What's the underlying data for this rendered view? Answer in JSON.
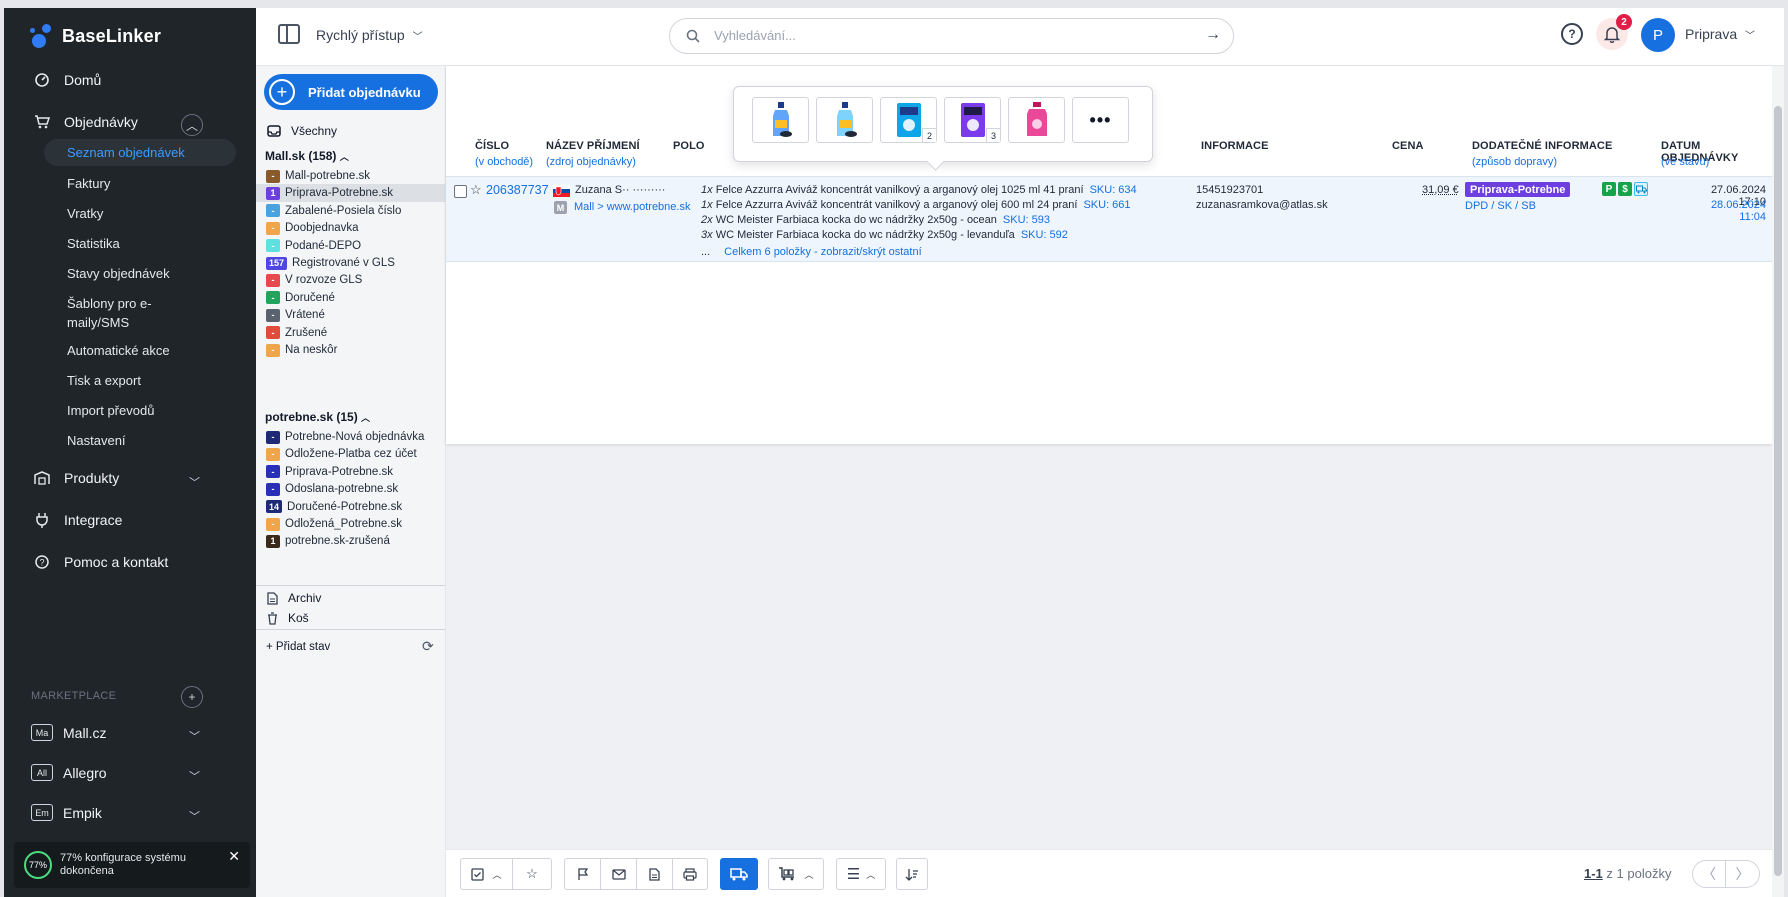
{
  "app": {
    "name": "BaseLinker"
  },
  "nav": {
    "home": "Domů",
    "orders": "Objednávky",
    "orders_sub": [
      "Seznam objednávek",
      "Faktury",
      "Vratky",
      "Statistika",
      "Stavy objednávek",
      "Šablony pro e-maily/SMS",
      "Automatické akce",
      "Tisk a export",
      "Import převodů",
      "Nastavení"
    ],
    "products": "Produkty",
    "integrations": "Integrace",
    "help": "Pomoc a kontakt",
    "marketplace_label": "MARKETPLACE",
    "marketplaces": [
      {
        "badge": "Ma",
        "name": "Mall.cz"
      },
      {
        "badge": "All",
        "name": "Allegro"
      },
      {
        "badge": "Em",
        "name": "Empik"
      }
    ],
    "config_percent": "77%",
    "config_text": "77% konfigurace systému dokončena"
  },
  "topbar": {
    "quick_access": "Rychlý přístup",
    "search_placeholder": "Vyhledávání...",
    "notifications": "2",
    "avatar_letter": "P",
    "user": "Priprava"
  },
  "statuses": {
    "add_order": "Přidat objednávku",
    "all": "Všechny",
    "group1": "Mall.sk (158)",
    "group1_items": [
      {
        "chip": "-",
        "color": "#8a5a2b",
        "label": "Mall-potrebne.sk"
      },
      {
        "chip": "1",
        "color": "#6d3fe0",
        "label": "Priprava-Potrebne.sk"
      },
      {
        "chip": "-",
        "color": "#4aa3df",
        "label": "Zabalené-Posiela číslo"
      },
      {
        "chip": "-",
        "color": "#f0a54a",
        "label": "Doobjednavka"
      },
      {
        "chip": "-",
        "color": "#5ee0e0",
        "label": "Podané-DEPO"
      },
      {
        "chip": "157",
        "color": "#4f46e5",
        "label": "Registrované v GLS"
      },
      {
        "chip": "-",
        "color": "#e5484d",
        "label": "V rozvoze GLS"
      },
      {
        "chip": "-",
        "color": "#22a45d",
        "label": "Doručené"
      },
      {
        "chip": "-",
        "color": "#5a6270",
        "label": "Vrátené"
      },
      {
        "chip": "-",
        "color": "#e04b3a",
        "label": "Zrušené"
      },
      {
        "chip": "-",
        "color": "#f0a54a",
        "label": "Na neskôr"
      }
    ],
    "group2": "potrebne.sk (15)",
    "group2_items": [
      {
        "chip": "-",
        "color": "#1e2a78",
        "label": "Potrebne-Nová objednávka"
      },
      {
        "chip": "-",
        "color": "#f0a54a",
        "label": "Odložene-Platba cez účet"
      },
      {
        "chip": "-",
        "color": "#2a2fb8",
        "label": "Priprava-Potrebne.sk"
      },
      {
        "chip": "-",
        "color": "#2a2fb8",
        "label": "Odoslana-potrebne.sk"
      },
      {
        "chip": "14",
        "color": "#1e2a78",
        "label": "Doručené-Potrebne.sk"
      },
      {
        "chip": "-",
        "color": "#f0a54a",
        "label": "Odložená_Potrebne.sk"
      },
      {
        "chip": "1",
        "color": "#3b2a1a",
        "label": "potrebne.sk-zrušená"
      }
    ],
    "archive": "Archiv",
    "trash": "Koš",
    "add_state": "+ Přidat stav"
  },
  "table": {
    "headers": {
      "number": "ČÍSLO",
      "number_sub": "(v obchodě)",
      "name": "NÁZEV PŘÍJMENÍ",
      "name_sub": "(zdroj objednávky)",
      "items": "POLO",
      "info": "INFORMACE",
      "price": "CENA",
      "extra": "DODATEČNÉ INFORMACE",
      "extra_sub": "(způsob dopravy)",
      "date": "DATUM OBJEDNÁVKY",
      "date_sub": "(ve stavu)"
    },
    "order": {
      "number": "206387737",
      "buyer": "Zuzana S·· ·········",
      "source_badge": "M",
      "source": "Mall > www.potrebne.sk",
      "items": [
        {
          "qty": "1x",
          "name": "Felce Azzurra Aviváž koncentrát vanilkový a arganový olej 1025 ml 41 praní",
          "sku": "SKU: 634"
        },
        {
          "qty": "1x",
          "name": "Felce Azzurra Aviváž koncentrát vanilkový a arganový olej 600 ml 24 praní",
          "sku": "SKU: 661"
        },
        {
          "qty": "2x",
          "name": "WC Meister Farbiaca kocka do wc nádržky 2x50g - ocean",
          "sku": "SKU: 593"
        },
        {
          "qty": "3x",
          "name": "WC Meister Farbiaca kocka do wc nádržky 2x50g - levanduľa",
          "sku": "SKU: 592"
        }
      ],
      "more_prefix": "...",
      "more": "Celkem 6 položky - zobrazit/skrýt ostatní",
      "phone": "15451923701",
      "email": "zuzanasramkova@atlas.sk",
      "price": "31,09 €",
      "status": "Priprava-Potrebne",
      "shipping": "DPD / SK / SB",
      "icon_p": "P",
      "icon_s": "$",
      "date_created": "27.06.2024 17:10",
      "date_status": "28.06.2024 11:04"
    },
    "thumb_qty": [
      "",
      "",
      "2",
      "3",
      ""
    ],
    "thumb_more": "•••"
  },
  "pager": {
    "range": "1-1",
    "of": "z 1 položky"
  }
}
